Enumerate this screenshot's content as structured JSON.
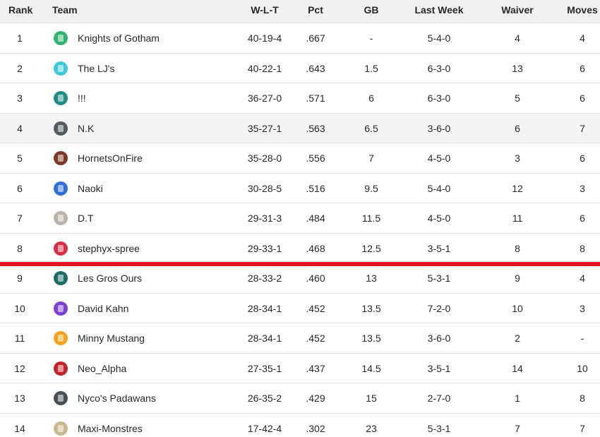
{
  "headers": {
    "rank": "Rank",
    "team": "Team",
    "wlt": "W-L-T",
    "pct": "Pct",
    "gb": "GB",
    "last_week": "Last Week",
    "waiver": "Waiver",
    "moves": "Moves"
  },
  "rows": [
    {
      "rank": "1",
      "team": "Knights of Gotham",
      "wlt": "40-19-4",
      "pct": ".667",
      "gb": "-",
      "last_week": "5-4-0",
      "waiver": "4",
      "moves": "4",
      "avatar_color": "#2fb36f"
    },
    {
      "rank": "2",
      "team": "The LJ's",
      "wlt": "40-22-1",
      "pct": ".643",
      "gb": "1.5",
      "last_week": "6-3-0",
      "waiver": "13",
      "moves": "6",
      "avatar_color": "#3ec9d6"
    },
    {
      "rank": "3",
      "team": "!!!",
      "wlt": "36-27-0",
      "pct": ".571",
      "gb": "6",
      "last_week": "6-3-0",
      "waiver": "5",
      "moves": "6",
      "avatar_color": "#1f8c86"
    },
    {
      "rank": "4",
      "team": "N.K",
      "wlt": "35-27-1",
      "pct": ".563",
      "gb": "6.5",
      "last_week": "3-6-0",
      "waiver": "6",
      "moves": "7",
      "avatar_color": "#555b60"
    },
    {
      "rank": "5",
      "team": "HornetsOnFire",
      "wlt": "35-28-0",
      "pct": ".556",
      "gb": "7",
      "last_week": "4-5-0",
      "waiver": "3",
      "moves": "6",
      "avatar_color": "#7a3b25"
    },
    {
      "rank": "6",
      "team": "Naoki",
      "wlt": "30-28-5",
      "pct": ".516",
      "gb": "9.5",
      "last_week": "5-4-0",
      "waiver": "12",
      "moves": "3",
      "avatar_color": "#2f6fd6"
    },
    {
      "rank": "7",
      "team": "D.T",
      "wlt": "29-31-3",
      "pct": ".484",
      "gb": "11.5",
      "last_week": "4-5-0",
      "waiver": "11",
      "moves": "6",
      "avatar_color": "#b9b2a8"
    },
    {
      "rank": "8",
      "team": "stephyx-spree",
      "wlt": "29-33-1",
      "pct": ".468",
      "gb": "12.5",
      "last_week": "3-5-1",
      "waiver": "8",
      "moves": "8",
      "avatar_color": "#d63045"
    },
    {
      "rank": "9",
      "team": "Les Gros Ours",
      "wlt": "28-33-2",
      "pct": ".460",
      "gb": "13",
      "last_week": "5-3-1",
      "waiver": "9",
      "moves": "4",
      "avatar_color": "#1d6b68"
    },
    {
      "rank": "10",
      "team": "David Kahn",
      "wlt": "28-34-1",
      "pct": ".452",
      "gb": "13.5",
      "last_week": "7-2-0",
      "waiver": "10",
      "moves": "3",
      "avatar_color": "#7b3fd1"
    },
    {
      "rank": "11",
      "team": "Minny Mustang",
      "wlt": "28-34-1",
      "pct": ".452",
      "gb": "13.5",
      "last_week": "3-6-0",
      "waiver": "2",
      "moves": "-",
      "avatar_color": "#f2a21c"
    },
    {
      "rank": "12",
      "team": "Neo_Alpha",
      "wlt": "27-35-1",
      "pct": ".437",
      "gb": "14.5",
      "last_week": "3-5-1",
      "waiver": "14",
      "moves": "10",
      "avatar_color": "#c0242c"
    },
    {
      "rank": "13",
      "team": "Nyco's Padawans",
      "wlt": "26-35-2",
      "pct": ".429",
      "gb": "15",
      "last_week": "2-7-0",
      "waiver": "1",
      "moves": "8",
      "avatar_color": "#4a4f55"
    },
    {
      "rank": "14",
      "team": "Maxi-Monstres",
      "wlt": "17-42-4",
      "pct": ".302",
      "gb": "23",
      "last_week": "5-3-1",
      "waiver": "7",
      "moves": "7",
      "avatar_color": "#c9b98a"
    }
  ]
}
